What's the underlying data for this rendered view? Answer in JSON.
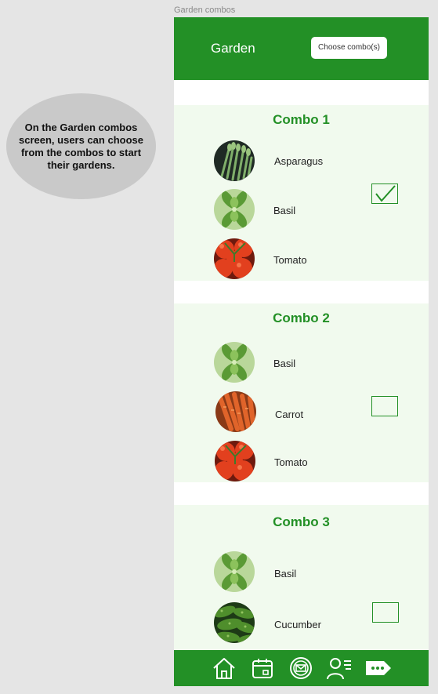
{
  "frame_label": "Garden combos",
  "annotation": "On the Garden combos screen, users can choose from the combos to start their gardens.",
  "header": {
    "title": "Garden",
    "choose_button": "Choose combo(s)"
  },
  "combos": [
    {
      "title": "Combo 1",
      "checked": true,
      "items": [
        "Asparagus",
        "Basil",
        "Tomato"
      ]
    },
    {
      "title": "Combo 2",
      "checked": false,
      "items": [
        "Basil",
        "Carrot",
        "Tomato"
      ]
    },
    {
      "title": "Combo 3",
      "checked": false,
      "items": [
        "Basil",
        "Cucumber"
      ]
    }
  ],
  "nav": [
    "home-icon",
    "calendar-icon",
    "mail-icon",
    "profile-list-icon",
    "more-tag-icon"
  ],
  "colors": {
    "brand_green": "#239026",
    "section_bg": "#f1faee",
    "page_bg": "#e5e5e5"
  }
}
